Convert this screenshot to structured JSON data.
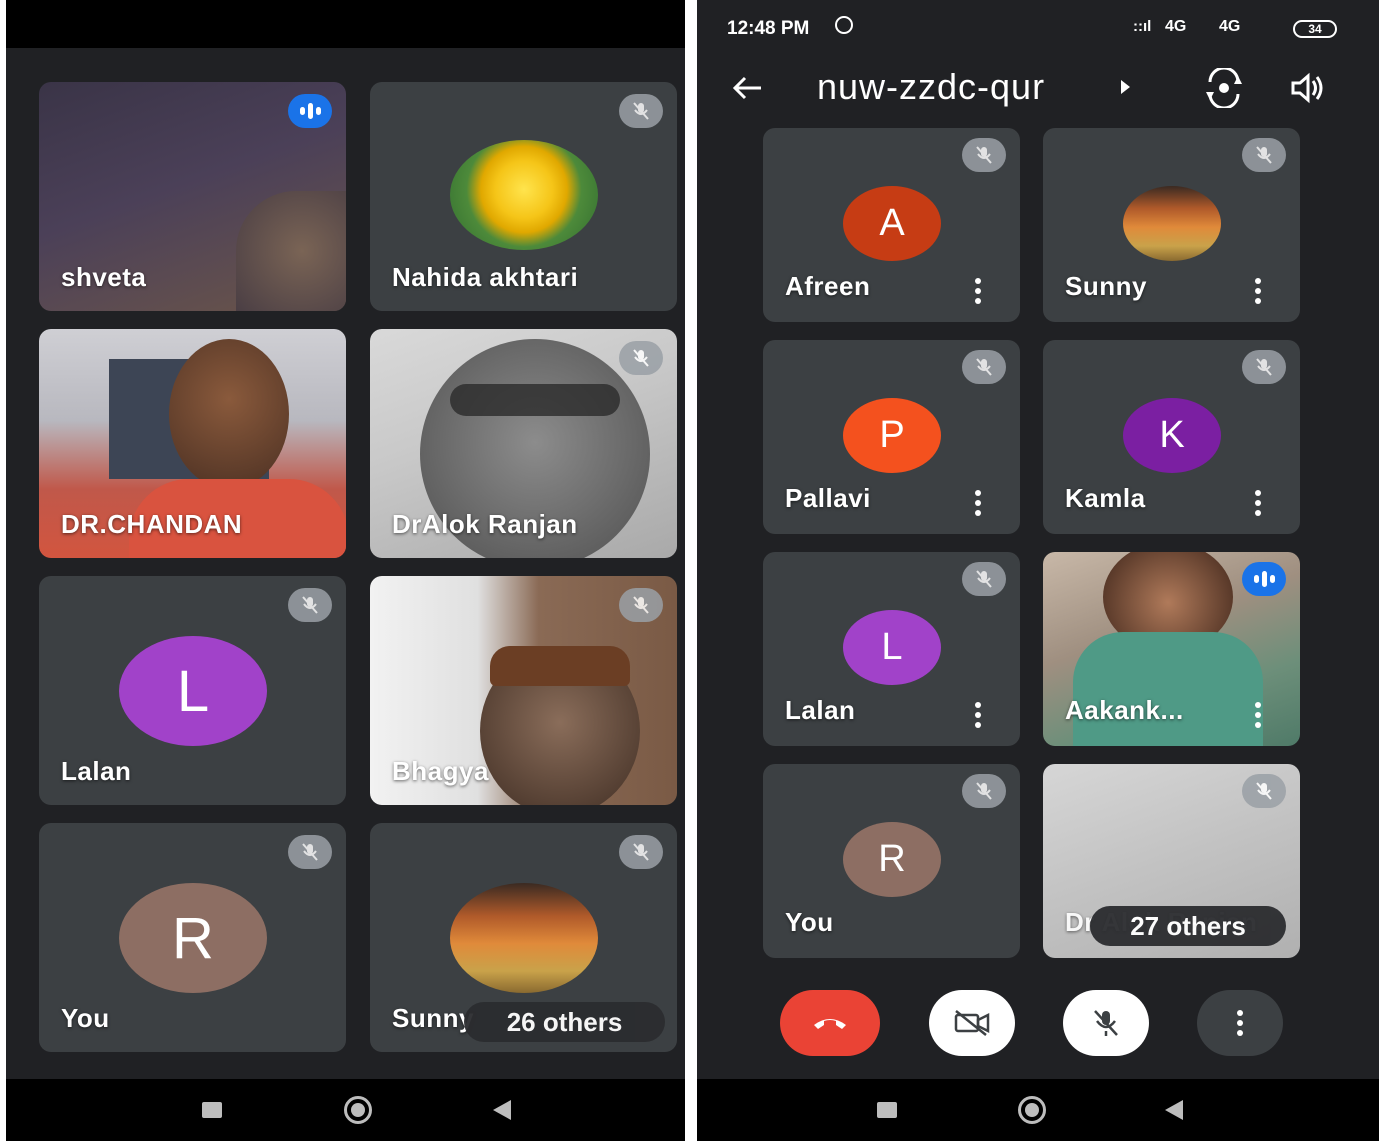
{
  "left_screen": {
    "tiles": [
      {
        "name": "shveta",
        "audio": "speaking"
      },
      {
        "name": "Nahida akhtari",
        "audio": "muted"
      },
      {
        "name": "DR.CHANDAN",
        "audio": "none"
      },
      {
        "name": "DrAlok Ranjan",
        "audio": "muted"
      },
      {
        "name": "Lalan",
        "initial": "L",
        "audio": "muted",
        "color": "#a142c9"
      },
      {
        "name": "Bhagya",
        "audio": "muted"
      },
      {
        "name": "You",
        "initial": "R",
        "audio": "muted",
        "color": "#8d6e63"
      },
      {
        "name": "Sunny",
        "audio": "muted"
      }
    ],
    "others_label": "26 others"
  },
  "right_screen": {
    "status": {
      "time": "12:48 PM",
      "network": "4G",
      "network2": "4G",
      "battery": "34"
    },
    "meeting_code": "nuw-zzdc-qur",
    "tiles": [
      {
        "name": "Afreen",
        "initial": "A",
        "audio": "muted",
        "color": "#c63c14"
      },
      {
        "name": "Sunny",
        "audio": "muted"
      },
      {
        "name": "Pallavi",
        "initial": "P",
        "audio": "muted",
        "color": "#f4511e"
      },
      {
        "name": "Kamla",
        "initial": "K",
        "audio": "muted",
        "color": "#7b1fa2"
      },
      {
        "name": "Lalan",
        "initial": "L",
        "audio": "muted",
        "color": "#a142c9"
      },
      {
        "name": "Aakank...",
        "audio": "speaking"
      },
      {
        "name": "You",
        "initial": "R",
        "audio": "muted",
        "color": "#8d6e63"
      },
      {
        "name": "Dr Alok Ranjan",
        "audio": "muted"
      }
    ],
    "others_label": "27 others"
  },
  "colors": {
    "end_call": "#ea4335",
    "tile_bg": "#3c4043",
    "speaking": "#1a73e8"
  },
  "icons": [
    "back-arrow-icon",
    "switch-camera-icon",
    "speaker-icon",
    "end-call-icon",
    "camera-off-icon",
    "mic-off-icon",
    "more-options-icon"
  ]
}
